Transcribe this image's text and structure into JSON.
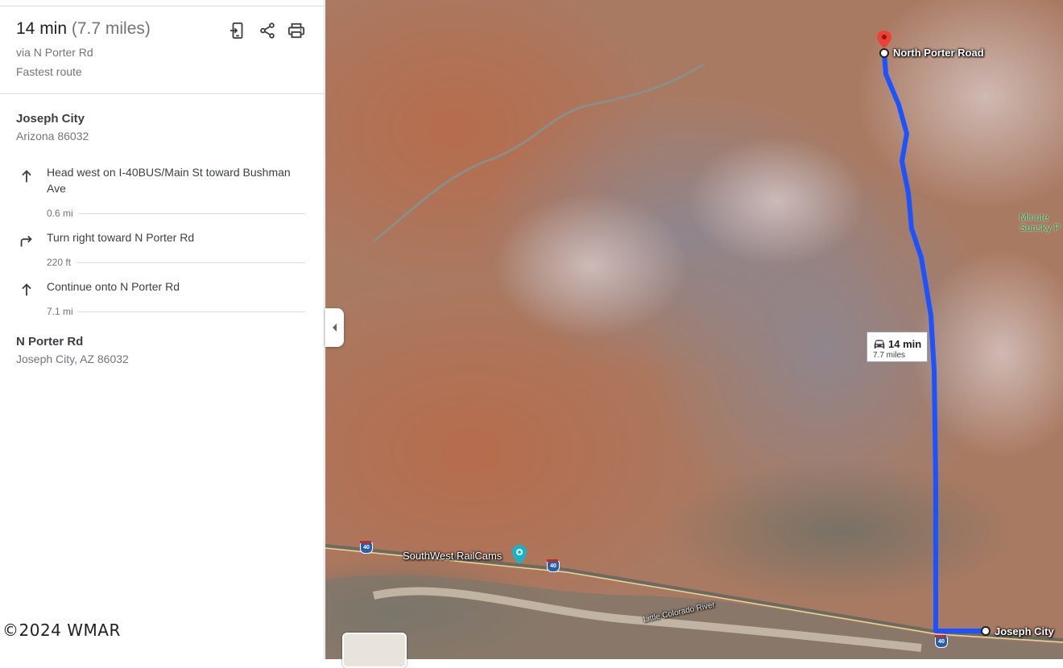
{
  "summary": {
    "time": "14 min",
    "distance": "(7.7 miles)",
    "via": "via N Porter Rd",
    "note": "Fastest route"
  },
  "header_buttons": {
    "send_icon": "send-to-phone-icon",
    "share_icon": "share-icon",
    "print_icon": "print-icon"
  },
  "origin": {
    "name": "Joseph City",
    "address": "Arizona 86032"
  },
  "steps": [
    {
      "icon": "arrow-straight-icon",
      "text": "Head west on I-40BUS/Main St toward Bushman Ave",
      "distance": "0.6 mi"
    },
    {
      "icon": "turn-right-icon",
      "text": "Turn right toward N Porter Rd",
      "distance": "220 ft"
    },
    {
      "icon": "arrow-straight-icon",
      "text": "Continue onto N Porter Rd",
      "distance": "7.1 mi"
    }
  ],
  "destination": {
    "name": "N Porter Rd",
    "address": "Joseph City, AZ 86032"
  },
  "copyright": "©2024 WMAR",
  "map": {
    "destination_label": "North Porter Road",
    "origin_label": "Joseph City",
    "poi_label": "SouthWest RailCams",
    "river_label": "Little Colorado River",
    "park_label_line1": "Minute",
    "park_label_line2": "Sunsky P",
    "route_time": "14 min",
    "route_distance": "7.7 miles",
    "highway_shield": "40",
    "route_color": "#1a53ff",
    "pin_color": "#ea4335"
  }
}
